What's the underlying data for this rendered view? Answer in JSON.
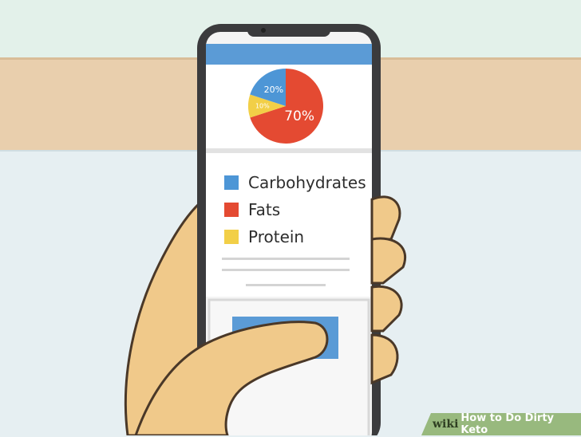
{
  "chart_data": {
    "type": "pie",
    "slices": [
      {
        "label": "Fats",
        "value": 70,
        "data_label": "70%",
        "color": "#e44a32"
      },
      {
        "label": "Protein",
        "value": 10,
        "data_label": "10%",
        "color": "#f2cf47"
      },
      {
        "label": "Carbohydrates",
        "value": 20,
        "data_label": "20%",
        "color": "#4d96d6"
      }
    ],
    "legend": [
      "Carbohydrates",
      "Fats",
      "Protein"
    ]
  },
  "legend": {
    "items": [
      {
        "label": "Carbohydrates",
        "color": "#4d96d6"
      },
      {
        "label": "Fats",
        "color": "#e44a32"
      },
      {
        "label": "Protein",
        "color": "#f2cf47"
      }
    ]
  },
  "watermark": {
    "brand": "wiki",
    "title": "How to Do Dirty Keto"
  },
  "colors": {
    "phone_frame": "#3b3b3d",
    "screen_header": "#5b9bd6",
    "button": "#5b9bd6",
    "skin": "#f0c98a"
  }
}
